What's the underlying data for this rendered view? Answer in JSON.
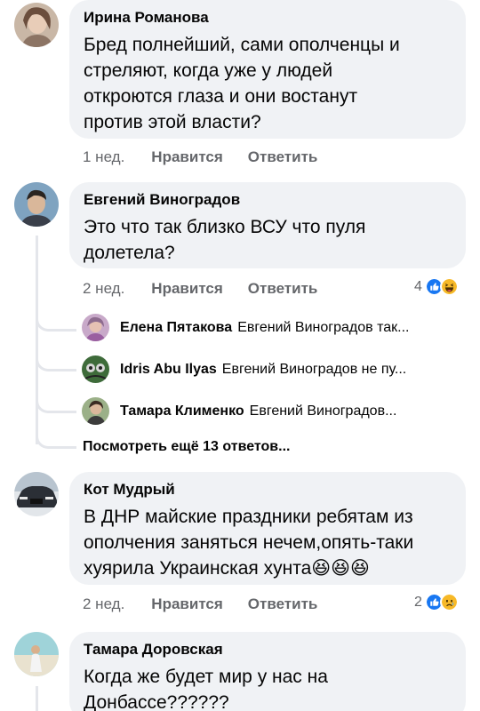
{
  "comments": [
    {
      "author": "Ирина Романова",
      "text": "Бред полнейший, сами ополченцы и\nстреляют, когда уже у людей\nоткроются глаза и они востанут\nпротив этой власти?",
      "time": "1 нед.",
      "like_label": "Нравится",
      "reply_label": "Ответить"
    },
    {
      "author": "Евгений Виноградов",
      "text": "Это что так близко ВСУ что пуля\nдолетела?",
      "time": "2 нед.",
      "like_label": "Нравится",
      "reply_label": "Ответить",
      "reaction_count": "4",
      "reactions": [
        "like-icon",
        "haha-icon"
      ],
      "replies": [
        {
          "name": "Елена Пятакова",
          "text": "Евгений Виноградов так..."
        },
        {
          "name": "Idris Abu Ilyas",
          "text": "Евгений Виноградов не пу..."
        },
        {
          "name": "Тамара Клименко",
          "text": "Евгений Виноградов..."
        }
      ],
      "more_replies": "Посмотреть ещё 13 ответов..."
    },
    {
      "author": "Кот Мудрый",
      "text": "В ДНР майские праздники ребятам из\nополчения заняться нечем,опять-таки\nхуярила Украинская хунта😆😆😆",
      "time": "2 нед.",
      "like_label": "Нравится",
      "reply_label": "Ответить",
      "reaction_count": "2",
      "reactions": [
        "like-icon",
        "sad-icon"
      ]
    },
    {
      "author": "Тамара Доровская",
      "text": "Когда же будет мир у нас на\nДонбассе??????"
    }
  ],
  "colors": {
    "bubble": "#f0f2f5",
    "meta": "#65676b",
    "like_blue": "#1877f2",
    "emoji_yellow": "#f7b928"
  }
}
